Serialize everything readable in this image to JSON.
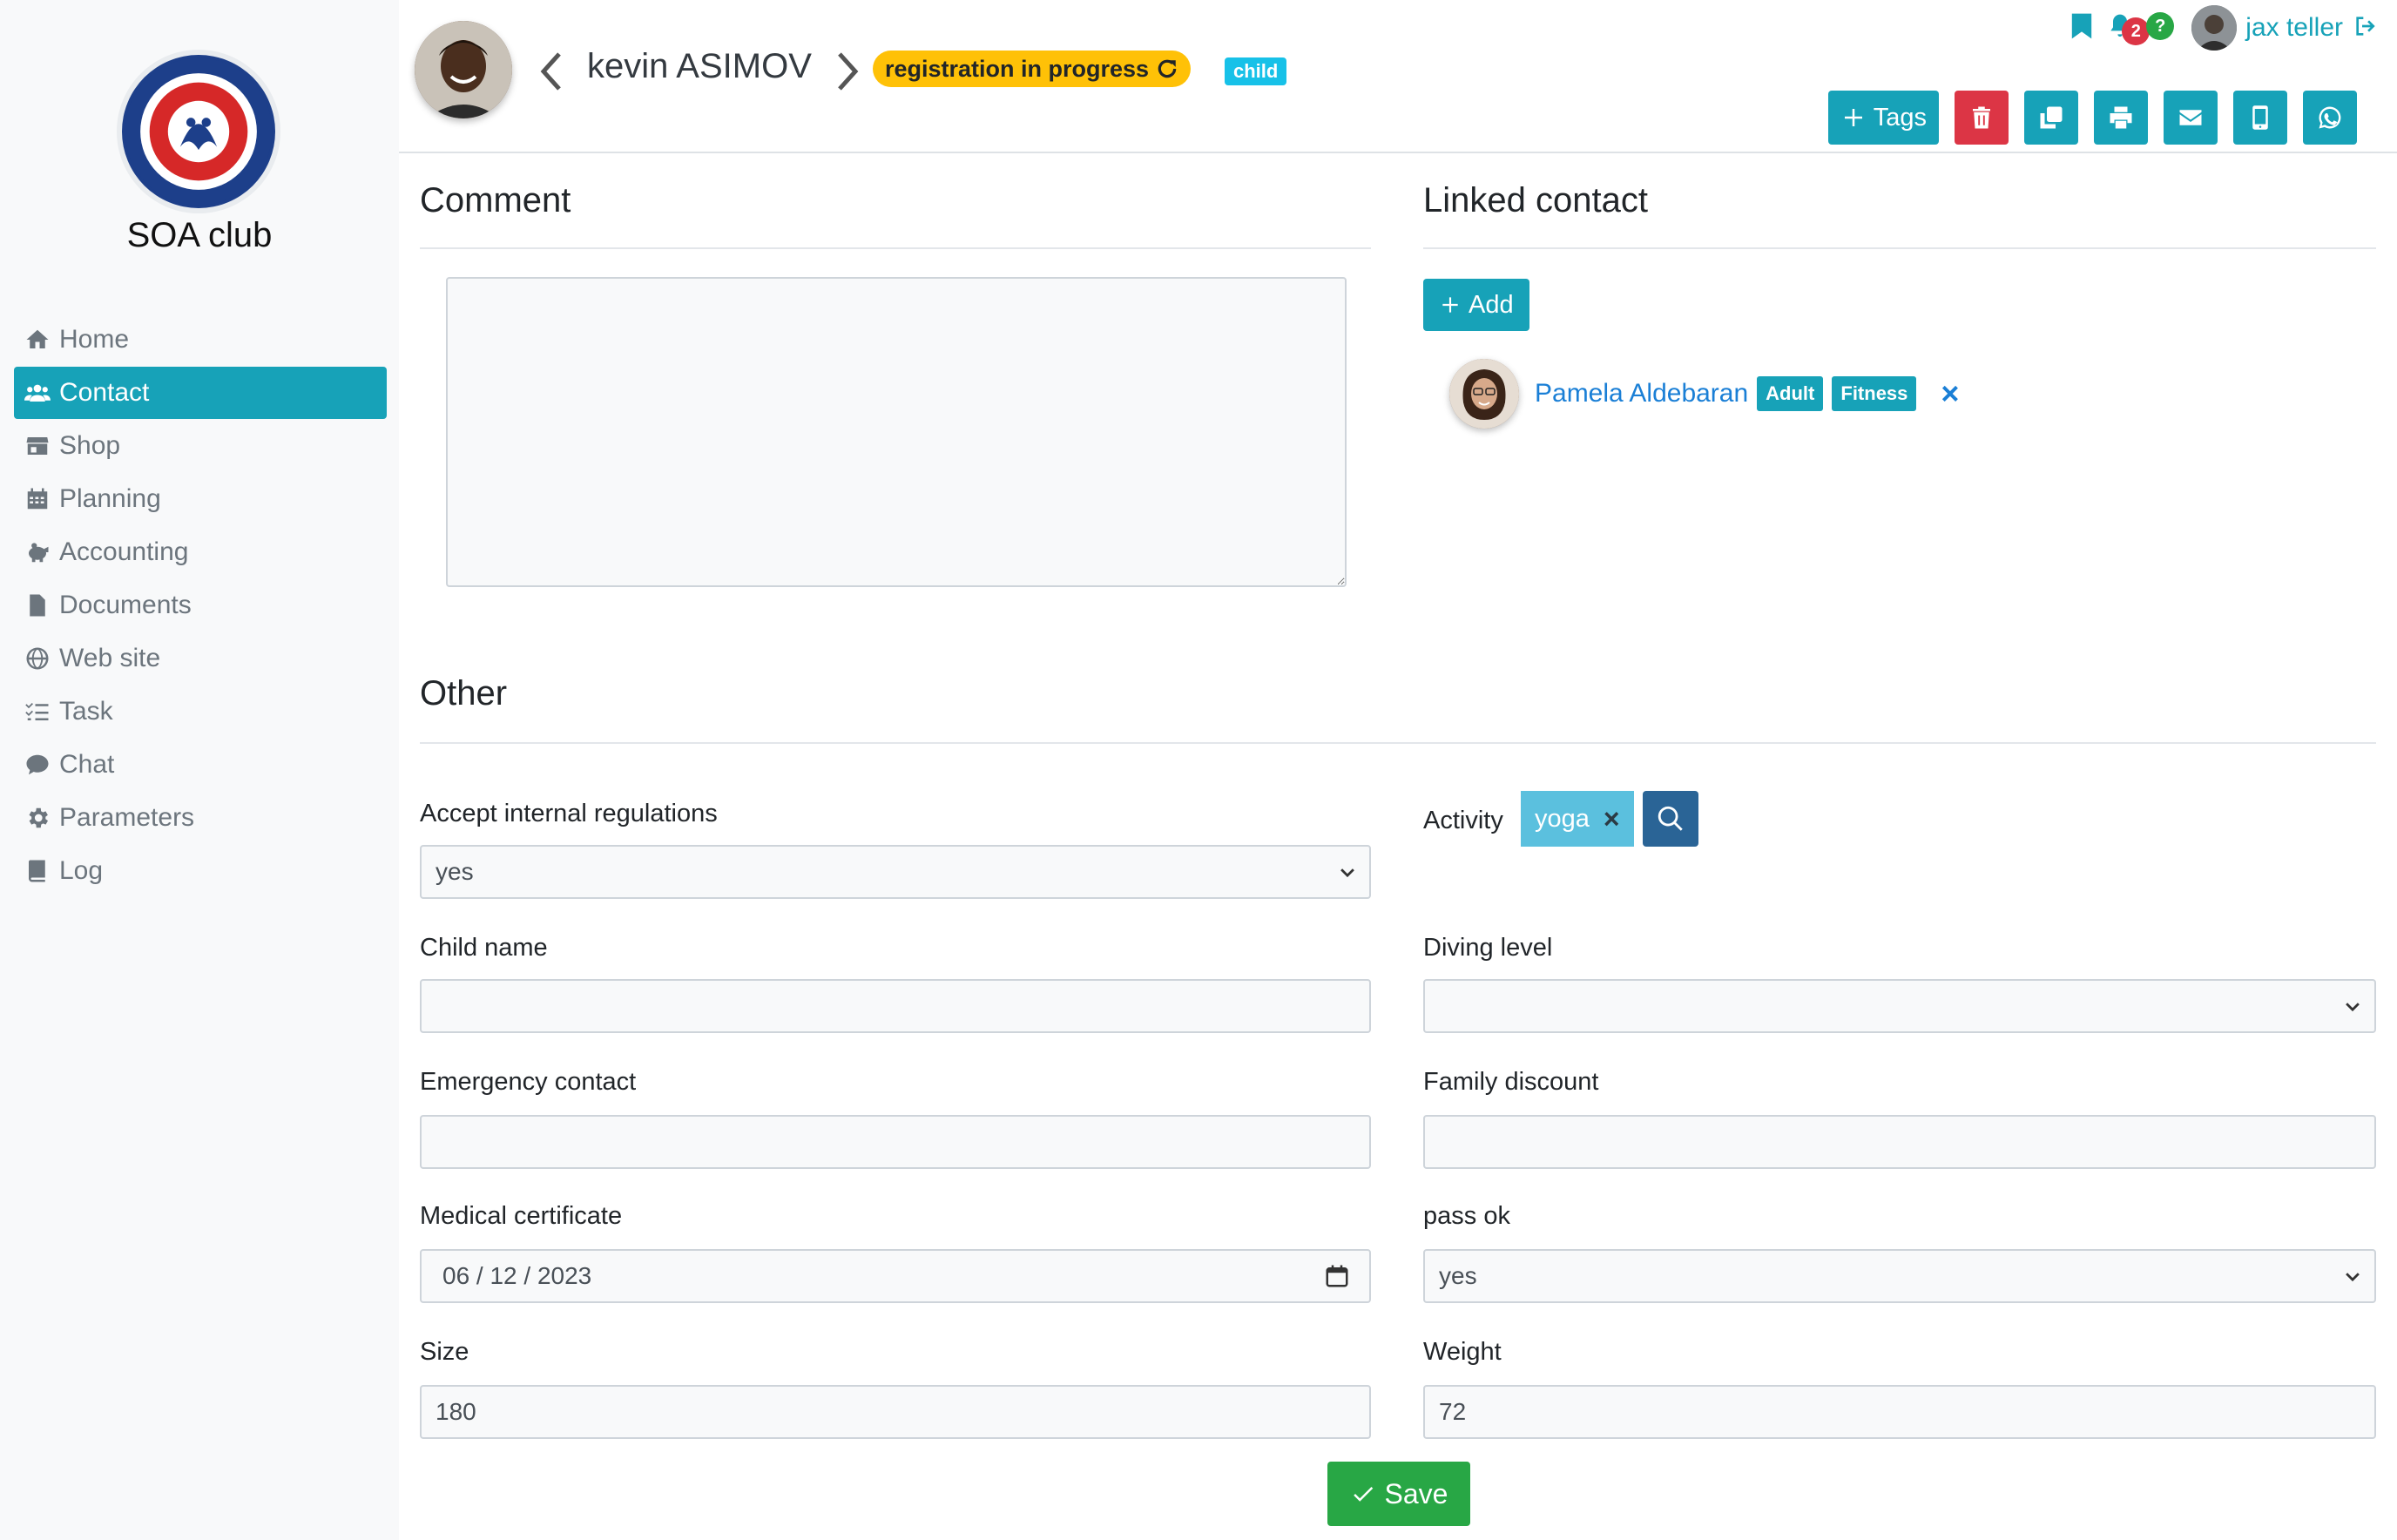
{
  "sidebar": {
    "club_name": "SOA club",
    "items": [
      {
        "label": "Home",
        "icon": "home-icon"
      },
      {
        "label": "Contact",
        "icon": "users-icon",
        "active": true
      },
      {
        "label": "Shop",
        "icon": "store-icon"
      },
      {
        "label": "Planning",
        "icon": "calendar-icon"
      },
      {
        "label": "Accounting",
        "icon": "piggy-bank-icon"
      },
      {
        "label": "Documents",
        "icon": "file-icon"
      },
      {
        "label": "Web site",
        "icon": "globe-icon"
      },
      {
        "label": "Task",
        "icon": "tasks-icon"
      },
      {
        "label": "Chat",
        "icon": "comment-icon"
      },
      {
        "label": "Parameters",
        "icon": "gear-icon"
      },
      {
        "label": "Log",
        "icon": "book-icon"
      }
    ]
  },
  "header": {
    "contact_name": "kevin ASIMOV",
    "status": "registration in progress",
    "type_badge": "child",
    "notification_count": "2",
    "help_badge": "?",
    "user_name": "jax teller",
    "toolbar": {
      "tags_label": "Tags",
      "icons": [
        "trash-icon",
        "copy-icon",
        "print-icon",
        "envelope-icon",
        "mobile-icon",
        "whatsapp-icon"
      ]
    }
  },
  "comment": {
    "title": "Comment",
    "value": ""
  },
  "linked_contact": {
    "title": "Linked contact",
    "add_label": "Add",
    "contacts": [
      {
        "name": "Pamela Aldebaran",
        "tags": [
          "Adult",
          "Fitness"
        ],
        "remove": "×"
      }
    ]
  },
  "other": {
    "title": "Other",
    "accept_regulations": {
      "label": "Accept internal regulations",
      "value": "yes"
    },
    "activity": {
      "label": "Activity",
      "value": "yoga",
      "remove": "×"
    },
    "child_name": {
      "label": "Child name",
      "value": ""
    },
    "diving_level": {
      "label": "Diving level",
      "value": ""
    },
    "emergency_contact": {
      "label": "Emergency contact",
      "value": ""
    },
    "family_discount": {
      "label": "Family discount",
      "value": ""
    },
    "medical_certificate": {
      "label": "Medical certificate",
      "value": "06 / 12 / 2023"
    },
    "pass_ok": {
      "label": "pass ok",
      "value": "yes"
    },
    "size": {
      "label": "Size",
      "value": "180"
    },
    "weight": {
      "label": "Weight",
      "value": "72"
    }
  },
  "save_label": "Save",
  "colors": {
    "accent": "#17a2b8",
    "danger": "#dc3545",
    "success": "#28a745",
    "warning": "#ffc107",
    "link": "#1a7fd6"
  }
}
